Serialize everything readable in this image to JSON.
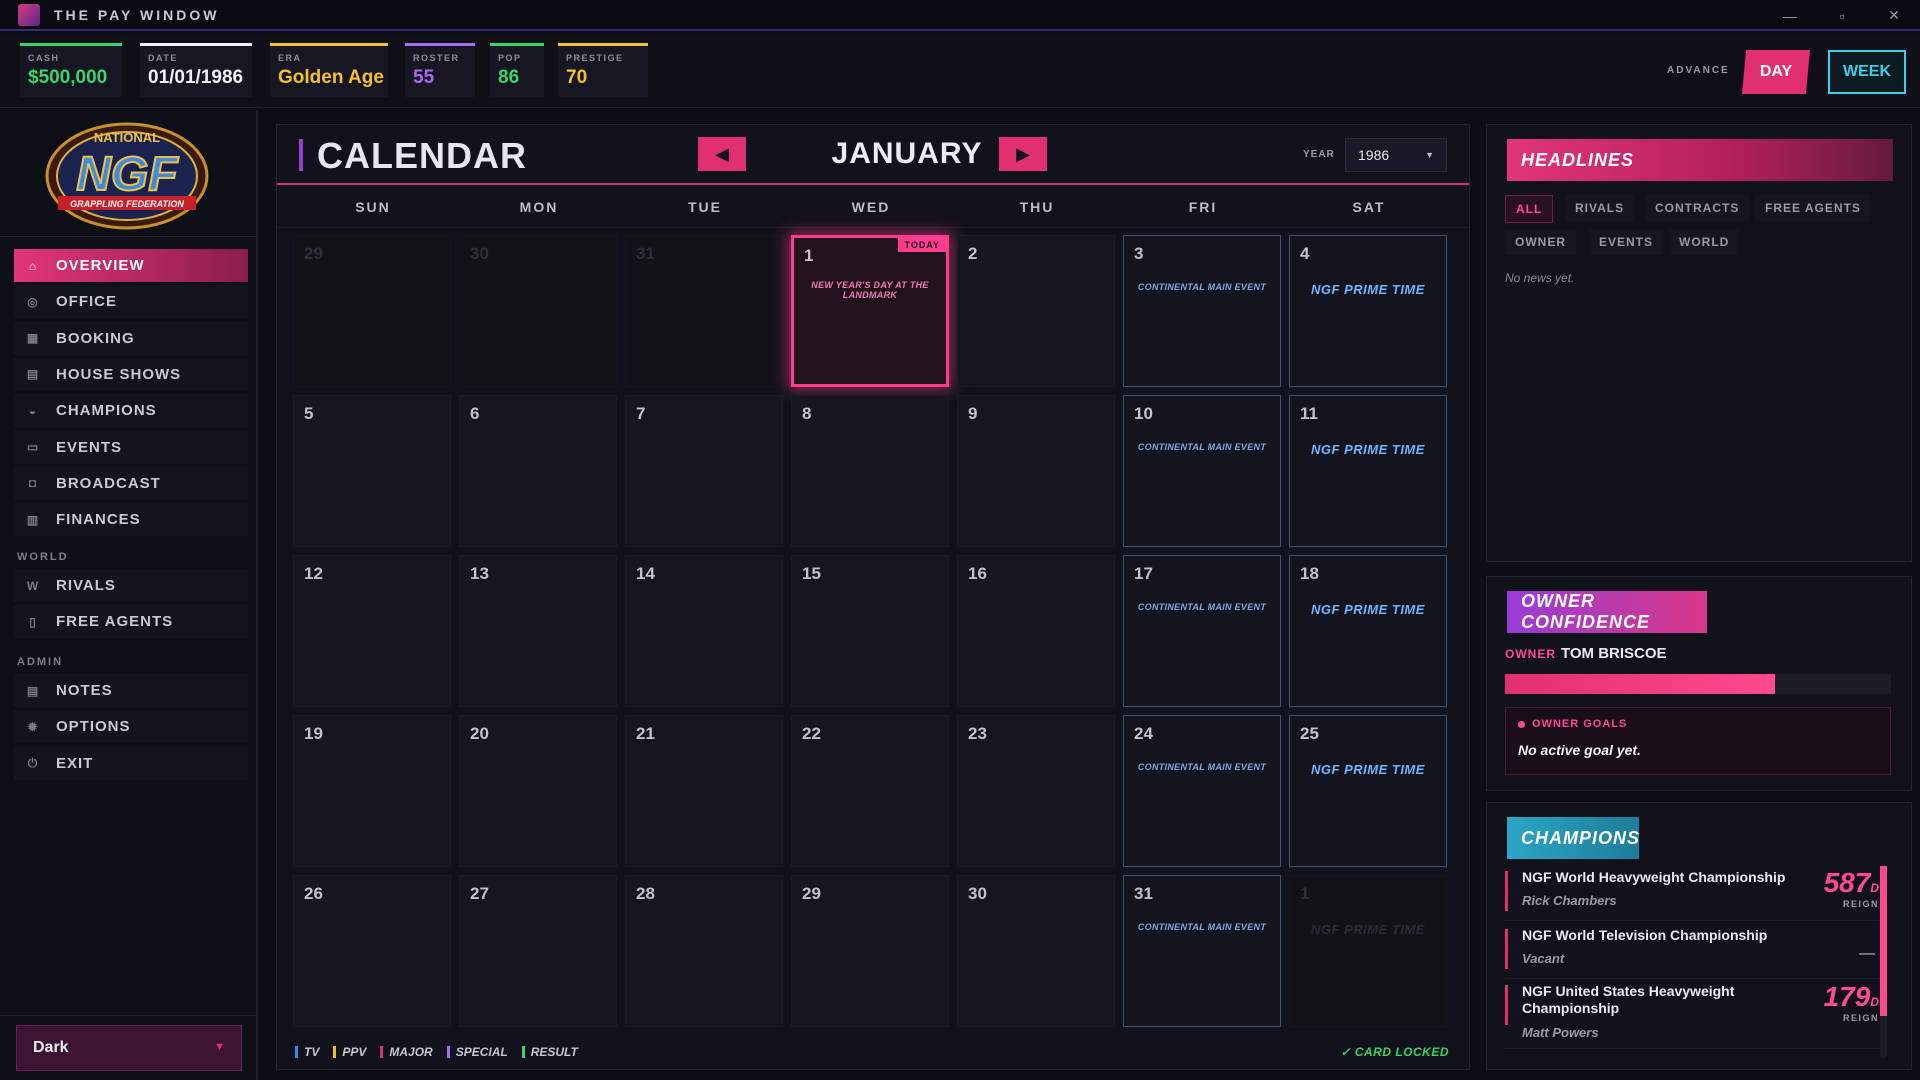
{
  "window": {
    "title": "THE PAY WINDOW",
    "minimize": "—",
    "maximize": "▫",
    "close": "✕"
  },
  "stats": [
    {
      "label": "CASH",
      "value": "$500,000",
      "color": "#3ad46a"
    },
    {
      "label": "DATE",
      "value": "01/01/1986",
      "color": "#f0f0f6"
    },
    {
      "label": "ERA",
      "value": "Golden Age",
      "color": "#f5c030"
    },
    {
      "label": "ROSTER",
      "value": "55",
      "color": "#a86af0"
    },
    {
      "label": "POP",
      "value": "86",
      "color": "#3ad46a"
    },
    {
      "label": "PRESTIGE",
      "value": "70",
      "color": "#f5c030"
    }
  ],
  "advance": {
    "label": "ADVANCE",
    "day": "DAY",
    "week": "WEEK"
  },
  "brand": {
    "top": "NATIONAL",
    "mark": "NGF",
    "bottom": "GRAPPLING FEDERATION"
  },
  "nav": {
    "items": [
      {
        "label": "OVERVIEW",
        "icon": "home-icon"
      },
      {
        "label": "OFFICE",
        "icon": "person-icon"
      },
      {
        "label": "BOOKING",
        "icon": "calendar-icon"
      },
      {
        "label": "HOUSE SHOWS",
        "icon": "ticket-icon"
      },
      {
        "label": "CHAMPIONS",
        "icon": "belt-icon"
      },
      {
        "label": "EVENTS",
        "icon": "screen-icon"
      },
      {
        "label": "BROADCAST",
        "icon": "camera-icon"
      },
      {
        "label": "FINANCES",
        "icon": "bar-chart-icon"
      }
    ],
    "world_label": "WORLD",
    "world_items": [
      {
        "label": "RIVALS",
        "icon": "versus-icon"
      },
      {
        "label": "FREE AGENTS",
        "icon": "document-icon"
      }
    ],
    "admin_label": "ADMIN",
    "admin_items": [
      {
        "label": "NOTES",
        "icon": "notes-icon"
      },
      {
        "label": "OPTIONS",
        "icon": "gear-icon"
      },
      {
        "label": "EXIT",
        "icon": "power-icon"
      }
    ]
  },
  "theme": {
    "value": "Dark"
  },
  "calendar": {
    "title": "CALENDAR",
    "month": "JANUARY",
    "year_label": "YEAR",
    "year": "1986",
    "today_tag": "TODAY",
    "days_of_week": [
      "SUN",
      "MON",
      "TUE",
      "WED",
      "THU",
      "FRI",
      "SAT"
    ],
    "weeks": [
      [
        {
          "d": "29",
          "faded": true
        },
        {
          "d": "30",
          "faded": true
        },
        {
          "d": "31",
          "faded": true
        },
        {
          "d": "1",
          "today": true,
          "event": "NEW YEAR'S DAY AT THE LANDMARK"
        },
        {
          "d": "2"
        },
        {
          "d": "3",
          "event": "CONTINENTAL MAIN EVENT"
        },
        {
          "d": "4",
          "event": "NGF PRIME TIME",
          "prime": true
        }
      ],
      [
        {
          "d": "5"
        },
        {
          "d": "6"
        },
        {
          "d": "7"
        },
        {
          "d": "8"
        },
        {
          "d": "9"
        },
        {
          "d": "10",
          "event": "CONTINENTAL MAIN EVENT"
        },
        {
          "d": "11",
          "event": "NGF PRIME TIME",
          "prime": true
        }
      ],
      [
        {
          "d": "12"
        },
        {
          "d": "13"
        },
        {
          "d": "14"
        },
        {
          "d": "15"
        },
        {
          "d": "16"
        },
        {
          "d": "17",
          "event": "CONTINENTAL MAIN EVENT"
        },
        {
          "d": "18",
          "event": "NGF PRIME TIME",
          "prime": true
        }
      ],
      [
        {
          "d": "19"
        },
        {
          "d": "20"
        },
        {
          "d": "21"
        },
        {
          "d": "22"
        },
        {
          "d": "23"
        },
        {
          "d": "24",
          "event": "CONTINENTAL MAIN EVENT"
        },
        {
          "d": "25",
          "event": "NGF PRIME TIME",
          "prime": true
        }
      ],
      [
        {
          "d": "26"
        },
        {
          "d": "27"
        },
        {
          "d": "28"
        },
        {
          "d": "29"
        },
        {
          "d": "30"
        },
        {
          "d": "31",
          "event": "CONTINENTAL MAIN EVENT"
        },
        {
          "d": "1",
          "faded": true,
          "event": "NGF PRIME TIME",
          "prime": true
        }
      ]
    ],
    "legend": [
      {
        "label": "TV",
        "color": "#3b8ae6"
      },
      {
        "label": "PPV",
        "color": "#f5c030"
      },
      {
        "label": "MAJOR",
        "color": "#e0306f"
      },
      {
        "label": "SPECIAL",
        "color": "#a86af0"
      },
      {
        "label": "RESULT",
        "color": "#3ad46a"
      }
    ],
    "card_locked": "✓ CARD LOCKED"
  },
  "headlines": {
    "title": "HEADLINES",
    "filters": [
      "ALL",
      "RIVALS",
      "CONTRACTS",
      "FREE AGENTS",
      "OWNER",
      "EVENTS",
      "WORLD"
    ],
    "active_filter": "ALL",
    "empty": "No news yet."
  },
  "owner_confidence": {
    "title": "OWNER CONFIDENCE",
    "owner_label": "OWNER",
    "owner_name": "TOM BRISCOE",
    "confidence_fraction": 0.7,
    "goals_title": "OWNER GOALS",
    "goals_text": "No active goal yet."
  },
  "champions": {
    "title": "CHAMPIONS",
    "reign_label": "REIGN",
    "items": [
      {
        "name": "NGF World Heavyweight Championship",
        "holder": "Rick Chambers",
        "days": "587",
        "unit": "D"
      },
      {
        "name": "NGF World Television Championship",
        "holder": "Vacant",
        "days": null,
        "dash": "—"
      },
      {
        "name": "NGF United States Heavyweight Championship",
        "holder": "Matt Powers",
        "days": "179",
        "unit": "D"
      }
    ]
  }
}
